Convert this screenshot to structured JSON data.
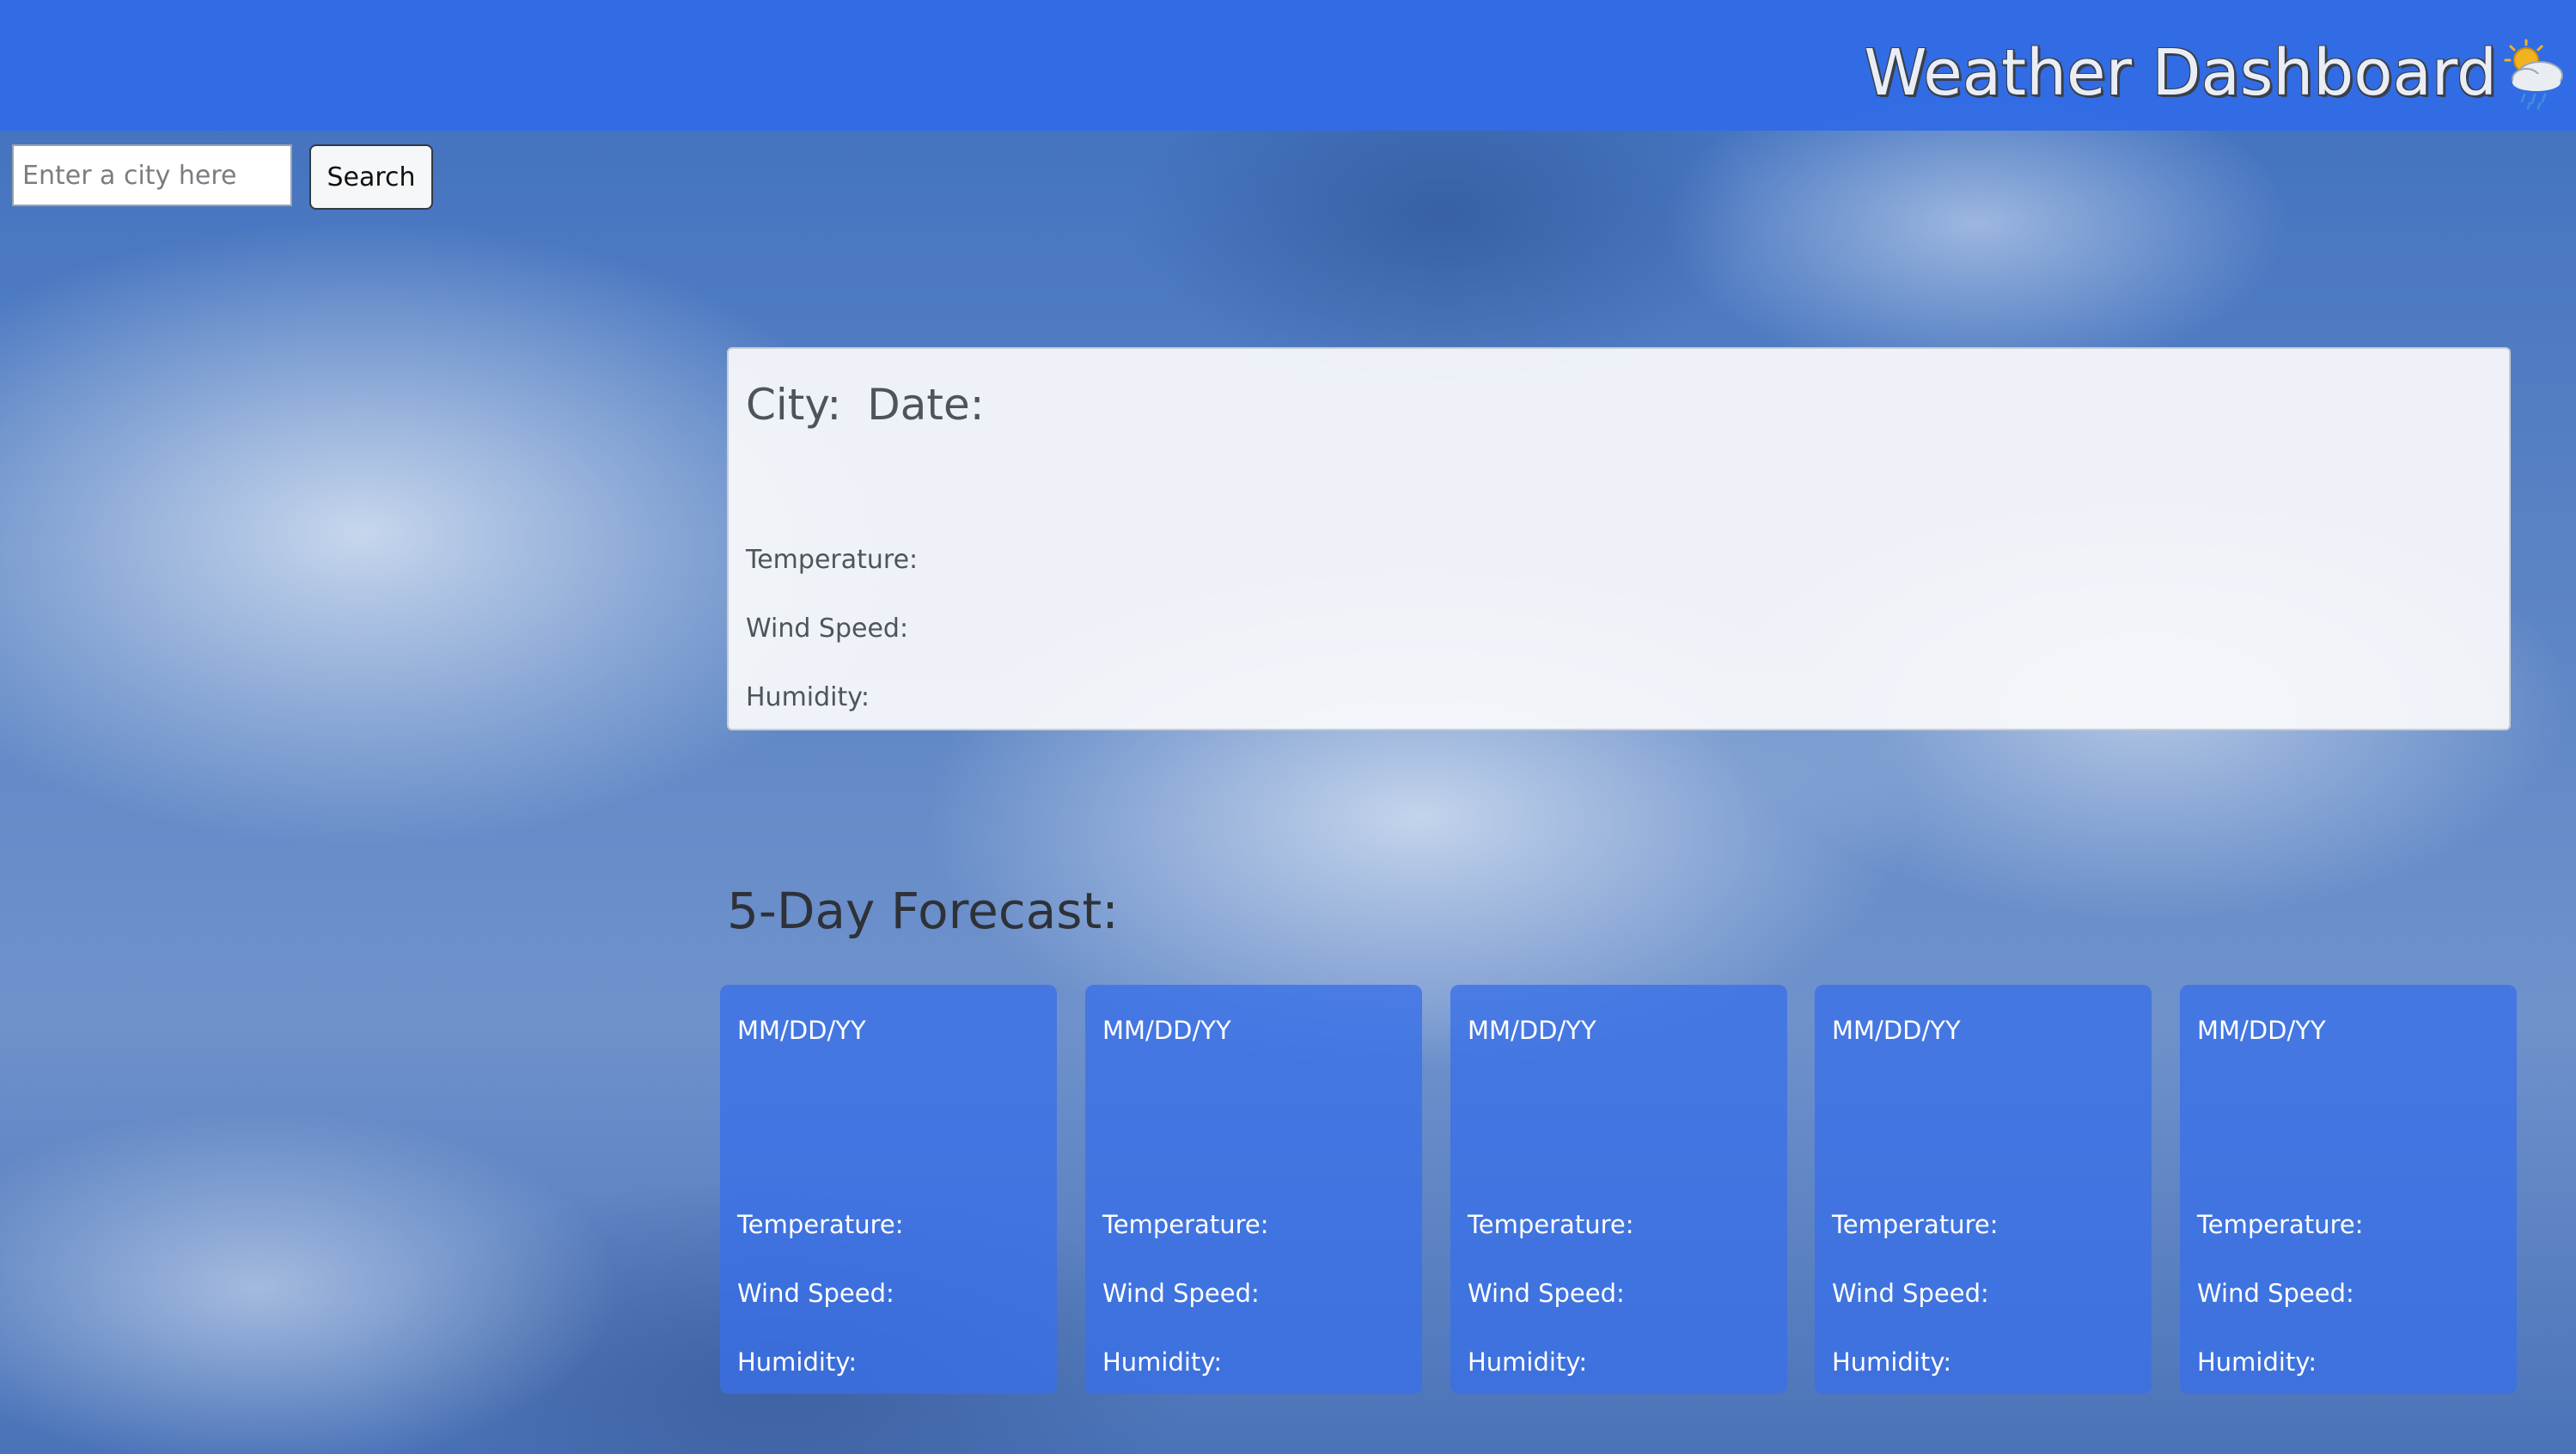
{
  "header": {
    "title": "Weather Dashboard",
    "icon": "sun-cloud-rain-icon",
    "background": "#316ce4"
  },
  "search": {
    "placeholder": "Enter a city here",
    "value": "",
    "button_label": "Search"
  },
  "current": {
    "city_label": "City:",
    "date_label": "Date:",
    "temperature_label": "Temperature:",
    "wind_label": "Wind Speed:",
    "humidity_label": "Humidity:"
  },
  "forecast": {
    "title": "5-Day Forecast:",
    "card_color": "#3870e8",
    "cards": [
      {
        "date": "MM/DD/YY",
        "temperature_label": "Temperature:",
        "wind_label": "Wind Speed:",
        "humidity_label": "Humidity:"
      },
      {
        "date": "MM/DD/YY",
        "temperature_label": "Temperature:",
        "wind_label": "Wind Speed:",
        "humidity_label": "Humidity:"
      },
      {
        "date": "MM/DD/YY",
        "temperature_label": "Temperature:",
        "wind_label": "Wind Speed:",
        "humidity_label": "Humidity:"
      },
      {
        "date": "MM/DD/YY",
        "temperature_label": "Temperature:",
        "wind_label": "Wind Speed:",
        "humidity_label": "Humidity:"
      },
      {
        "date": "MM/DD/YY",
        "temperature_label": "Temperature:",
        "wind_label": "Wind Speed:",
        "humidity_label": "Humidity:"
      }
    ]
  }
}
